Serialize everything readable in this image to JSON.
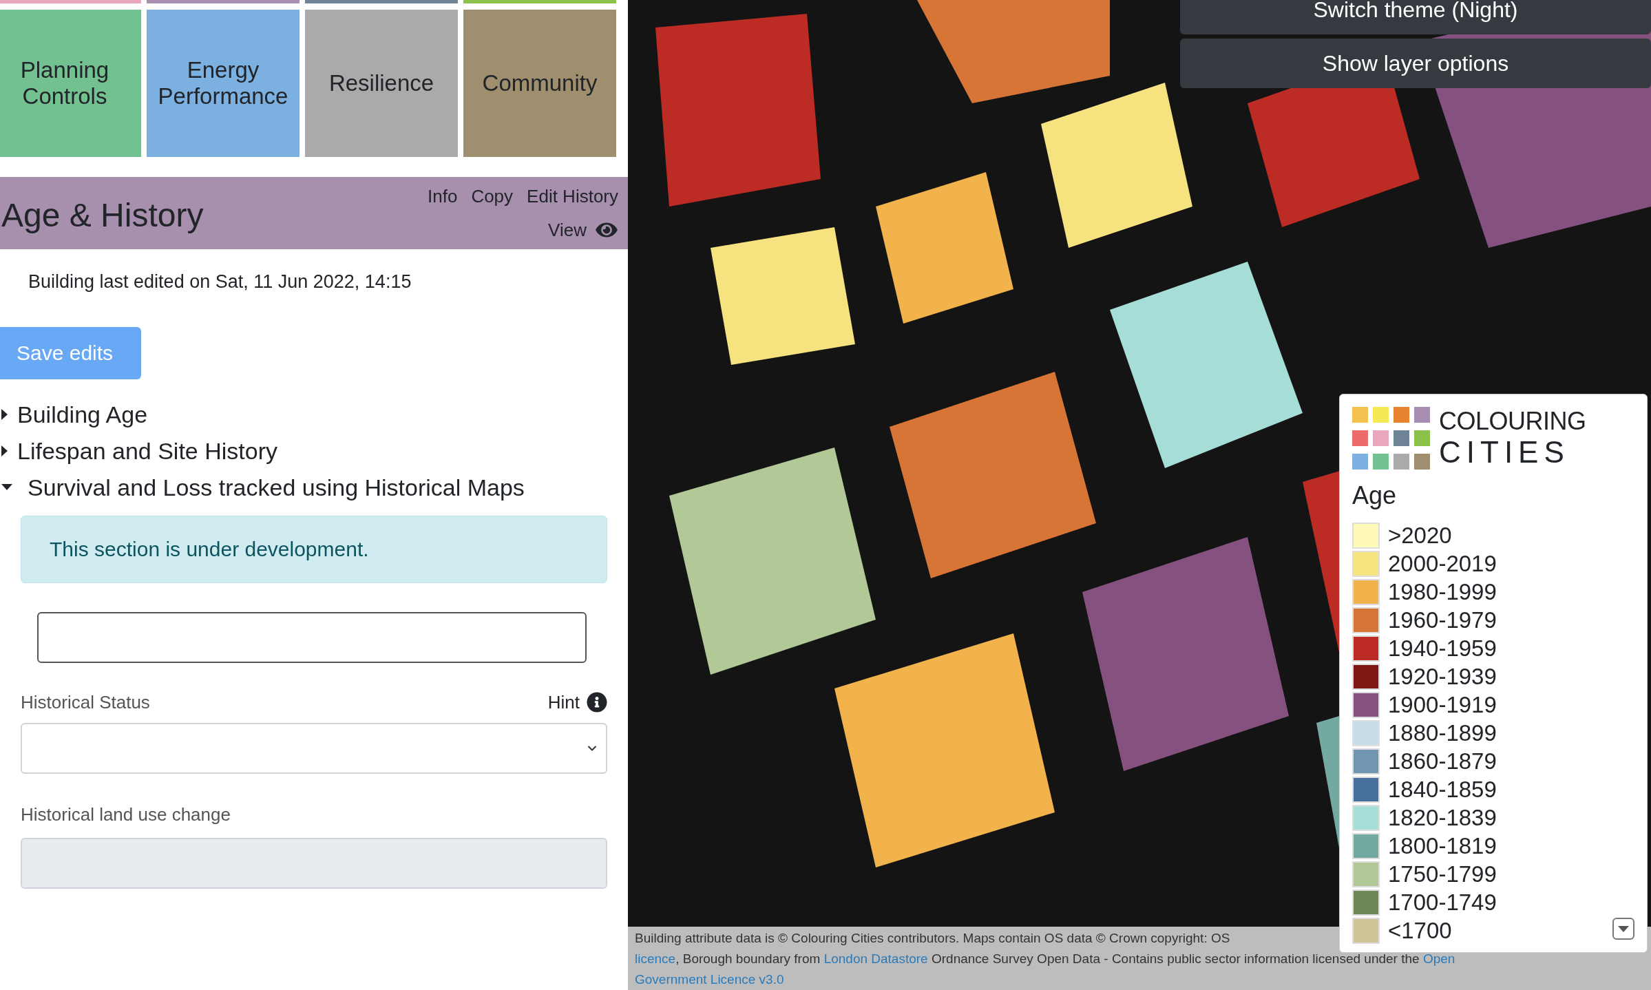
{
  "category_strips": [
    {
      "color": "#e8a7bd"
    },
    {
      "color": "#a58eaf"
    },
    {
      "color": "#6f8497"
    },
    {
      "color": "#8bc34a"
    }
  ],
  "categories": [
    {
      "label": "Planning Controls",
      "color": "#73c091"
    },
    {
      "label": "Energy Performance",
      "color": "#7cb0e0"
    },
    {
      "label": "Resilience",
      "color": "#aaaaaa"
    },
    {
      "label": "Community",
      "color": "#9f8f6e"
    }
  ],
  "header": {
    "title": "Age & History",
    "links": [
      "Info",
      "Copy",
      "Edit History"
    ],
    "view": "View"
  },
  "last_edited": "Building last edited on Sat, 11 Jun 2022, 14:15",
  "save_button": "Save edits",
  "sections": [
    {
      "title": "Building Age",
      "expanded": false
    },
    {
      "title": "Lifespan and Site History",
      "expanded": false
    },
    {
      "title": "Survival and Loss tracked using Historical Maps",
      "expanded": true
    }
  ],
  "alert": "This section is under development.",
  "fields": [
    {
      "kind": "select",
      "label": "Historical Status",
      "hint": "Hint"
    },
    {
      "kind": "text",
      "label": "Historical land use change",
      "disabled": true
    }
  ],
  "map_buttons": [
    "Switch theme (Night)",
    "Show layer options"
  ],
  "legend": {
    "logo_lines": [
      "COLOURING",
      "CITIES"
    ],
    "title": "Age",
    "items": [
      {
        "label": ">2020",
        "color": "#fff9b8"
      },
      {
        "label": "2000-2019",
        "color": "#f6e27f"
      },
      {
        "label": "1980-1999",
        "color": "#f2b34d"
      },
      {
        "label": "1960-1979",
        "color": "#d77536"
      },
      {
        "label": "1940-1959",
        "color": "#bc2c25"
      },
      {
        "label": "1920-1939",
        "color": "#7e1712"
      },
      {
        "label": "1900-1919",
        "color": "#85527f"
      },
      {
        "label": "1880-1899",
        "color": "#c7dde9"
      },
      {
        "label": "1860-1879",
        "color": "#7196b2"
      },
      {
        "label": "1840-1859",
        "color": "#48709c"
      },
      {
        "label": "1820-1839",
        "color": "#a7ddd7"
      },
      {
        "label": "1800-1819",
        "color": "#74a9a1"
      },
      {
        "label": "1750-1799",
        "color": "#b2c997"
      },
      {
        "label": "1700-1749",
        "color": "#6e8754"
      },
      {
        "label": "<1700",
        "color": "#cfc497"
      }
    ]
  },
  "attribution": {
    "lines": [
      [
        {
          "text": "Building attribute data is © Colouring Cities contributors. Maps contain OS data © Crown copyright: OS",
          "kind": "text"
        }
      ],
      [
        {
          "text": "licence",
          "kind": "link"
        },
        {
          "text": ", Borough boundary from ",
          "kind": "text"
        },
        {
          "text": "London Datastore",
          "kind": "link"
        },
        {
          "text": " Ordnance Survey Open Data - Contains public sector information licensed under the ",
          "kind": "text"
        },
        {
          "text": "Open",
          "kind": "link"
        }
      ],
      [
        {
          "text": "Government Licence v3.0",
          "kind": "link"
        }
      ]
    ]
  }
}
